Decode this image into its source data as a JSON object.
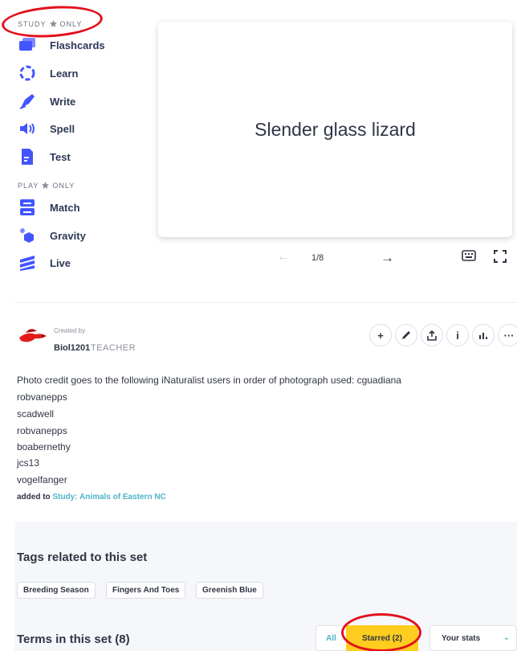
{
  "sidebar": {
    "study_label_pre": "STUDY",
    "study_label_post": "ONLY",
    "play_label_pre": "PLAY",
    "play_label_post": "ONLY",
    "study_items": [
      {
        "label": "Flashcards",
        "icon": "flashcards-icon"
      },
      {
        "label": "Learn",
        "icon": "learn-icon"
      },
      {
        "label": "Write",
        "icon": "write-icon"
      },
      {
        "label": "Spell",
        "icon": "spell-icon"
      },
      {
        "label": "Test",
        "icon": "test-icon"
      }
    ],
    "play_items": [
      {
        "label": "Match",
        "icon": "match-icon"
      },
      {
        "label": "Gravity",
        "icon": "gravity-icon"
      },
      {
        "label": "Live",
        "icon": "live-icon"
      }
    ]
  },
  "flashcard": {
    "term": "Slender glass lizard",
    "counter": "1/8"
  },
  "creator": {
    "created_by": "Created by",
    "name": "Biol1201",
    "role": "TEACHER"
  },
  "description": {
    "lines": [
      "Photo credit goes to the following iNaturalist users in order of photograph used: cguadiana",
      "robvanepps",
      "scadwell",
      "robvanepps",
      "boabernethy",
      "jcs13",
      "vogelfanger"
    ],
    "added_prefix": "added to",
    "added_link": "Study: Animals of Eastern NC"
  },
  "tags": {
    "title": "Tags related to this set",
    "items": [
      "Breeding Season",
      "Fingers And Toes",
      "Greenish Blue"
    ]
  },
  "terms": {
    "title": "Terms in this set (8)",
    "filter_all": "All",
    "filter_starred": "Starred (2)",
    "stats_select": "Your stats"
  },
  "colors": {
    "accent_blue": "#4255ff",
    "starred_yellow": "#ffcd1f",
    "link_teal": "#4fb3c8",
    "annotation_red": "#e3101b"
  }
}
